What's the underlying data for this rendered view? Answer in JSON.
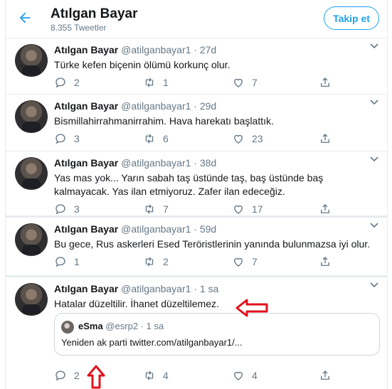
{
  "header": {
    "back_icon": "arrow-left-icon",
    "name": "Atılgan Bayar",
    "subtitle": "8.355 Tweetler",
    "follow_label": "Takip et"
  },
  "colors": {
    "accent": "#1da1f2",
    "muted": "#657786",
    "annotation": "#e0121d"
  },
  "tweets": [
    {
      "name": "Atılgan Bayar",
      "handle_time": "@atilganbayar1 · 27d",
      "text": "Türke kefen biçenin ölümü korkunç olur.",
      "replies": "2",
      "retweets": "1",
      "likes": "7"
    },
    {
      "name": "Atılgan Bayar",
      "handle_time": "@atilganbayar1 · 29d",
      "text": "Bismillahirrahmanirrahim. Hava harekatı başlattık.",
      "replies": "3",
      "retweets": "6",
      "likes": "23"
    },
    {
      "name": "Atılgan Bayar",
      "handle_time": "@atilganbayar1 · 38d",
      "text": "Yas mas yok... Yarın sabah taş üstünde taş, baş üstünde baş kalmayacak. Yas ilan etmiyoruz. Zafer ilan edeceğiz.",
      "replies": "3",
      "retweets": "7",
      "likes": "17"
    },
    {
      "name": "Atılgan Bayar",
      "handle_time": "@atilganbayar1 · 59d",
      "text": "Bu gece, Rus askerleri Esed Teröristlerinin yanında bulunmazsa iyi olur.",
      "replies": "1",
      "retweets": "2",
      "likes": "7"
    },
    {
      "name": "Atılgan Bayar",
      "handle_time": "@atilganbayar1 · 1 sa",
      "text": "Hatalar düzeltilir. İhanet düzeltilemez.",
      "replies": "2",
      "retweets": "4",
      "likes": "4",
      "quote": {
        "name": "eSma",
        "handle_time": "@esrp2 · 1 sa",
        "text": "Yeniden ak parti twitter.com/atilganbayar1/..."
      }
    }
  ]
}
